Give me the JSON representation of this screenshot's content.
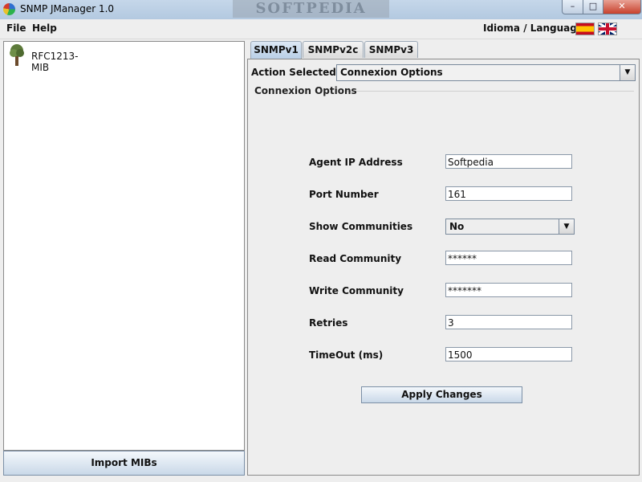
{
  "window": {
    "title": "SNMP JManager 1.0",
    "watermark": "SOFTPEDIA",
    "minimize": "–",
    "maximize": "□",
    "close": "✕"
  },
  "menu": {
    "file": "File",
    "help": "Help",
    "language_label": "Idioma / Language"
  },
  "tree": {
    "items": [
      {
        "label": "RFC1213-MIB",
        "icon": "tree-icon"
      }
    ]
  },
  "left": {
    "import_button": "Import MIBs"
  },
  "tabs": [
    {
      "label": "SNMPv1",
      "active": true
    },
    {
      "label": "SNMPv2c"
    },
    {
      "label": "SNMPv3"
    }
  ],
  "action": {
    "label": "Action Selected",
    "value": "Connexion Options"
  },
  "group": {
    "title": "Connexion Options"
  },
  "fields": {
    "agent_ip": {
      "label": "Agent IP Address",
      "value": "Softpedia"
    },
    "port": {
      "label": "Port Number",
      "value": "161"
    },
    "show_communities": {
      "label": "Show Communities",
      "value": "No"
    },
    "read_community": {
      "label": "Read Community",
      "value": "******"
    },
    "write_community": {
      "label": "Write Community",
      "value": "*******"
    },
    "retries": {
      "label": "Retries",
      "value": "3"
    },
    "timeout": {
      "label": "TimeOut (ms)",
      "value": "1500"
    }
  },
  "apply_button": "Apply Changes",
  "colors": {
    "accent": "#b9cfe7",
    "close": "#c8412c"
  }
}
